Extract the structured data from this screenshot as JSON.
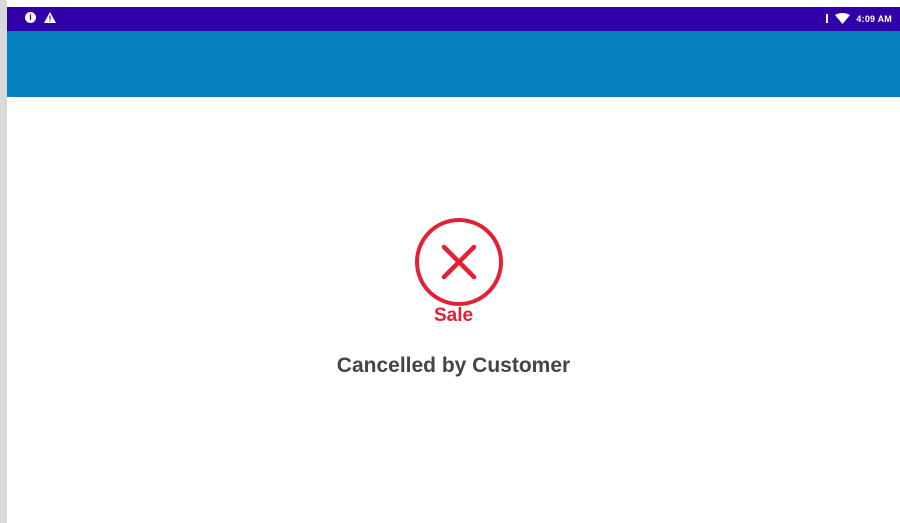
{
  "status_bar": {
    "time": "4:09 AM",
    "left_icons": [
      "info-icon",
      "warning-icon"
    ],
    "right_icons": [
      "signal-icon",
      "wifi-icon"
    ],
    "background_color": "#3200a8"
  },
  "app_bar": {
    "background_color": "#0581be"
  },
  "result": {
    "icon": "cancel-x-circle-icon",
    "title": "Sale",
    "message": "Cancelled by Customer",
    "accent_color": "#e32035"
  }
}
